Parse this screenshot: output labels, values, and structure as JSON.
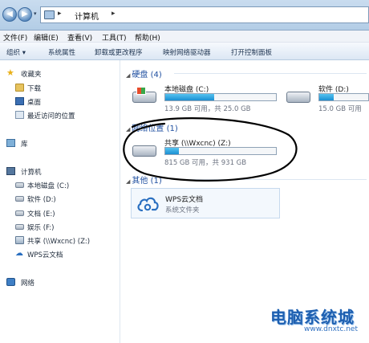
{
  "address": {
    "location": "计算机"
  },
  "menu": [
    "文件(F)",
    "编辑(E)",
    "查看(V)",
    "工具(T)",
    "帮助(H)"
  ],
  "toolbar": [
    "组织 ▾",
    "系统属性",
    "卸载或更改程序",
    "映射网络驱动器",
    "打开控制面板"
  ],
  "sidebar": {
    "favorites_header": "收藏夹",
    "favorites": [
      "下载",
      "桌面",
      "最近访问的位置"
    ],
    "libraries": "库",
    "computer": "计算机",
    "drives": [
      "本地磁盘 (C:)",
      "软件 (D:)",
      "文档 (E:)",
      "娱乐 (F:)",
      "共享 (\\\\Wxcnc) (Z:)",
      "WPS云文档"
    ],
    "network": "网络"
  },
  "main": {
    "hard_disks_header": "硬盘 (4)",
    "network_header": "网络位置 (1)",
    "other_header": "其他 (1)",
    "drives": [
      {
        "name": "本地磁盘 (C:)",
        "free_text": "13.9 GB 可用，共 25.0 GB",
        "used_fraction": 0.44
      },
      {
        "name": "软件 (D:)",
        "free_text": "15.0 GB 可用",
        "used_fraction": 0.3
      },
      {
        "name": "共享 (\\\\Wxcnc) (Z:)",
        "free_text": "815 GB 可用，共 931 GB",
        "used_fraction": 0.12
      }
    ],
    "wps": {
      "name": "WPS云文档",
      "sub": "系统文件夹"
    }
  },
  "watermark": {
    "title": "电脑系统城",
    "url": "www.dnxtc.net"
  },
  "colors": {
    "accent": "#1f4fa0",
    "bar_fill": "#1b8fd2",
    "annotation": "#000000"
  }
}
